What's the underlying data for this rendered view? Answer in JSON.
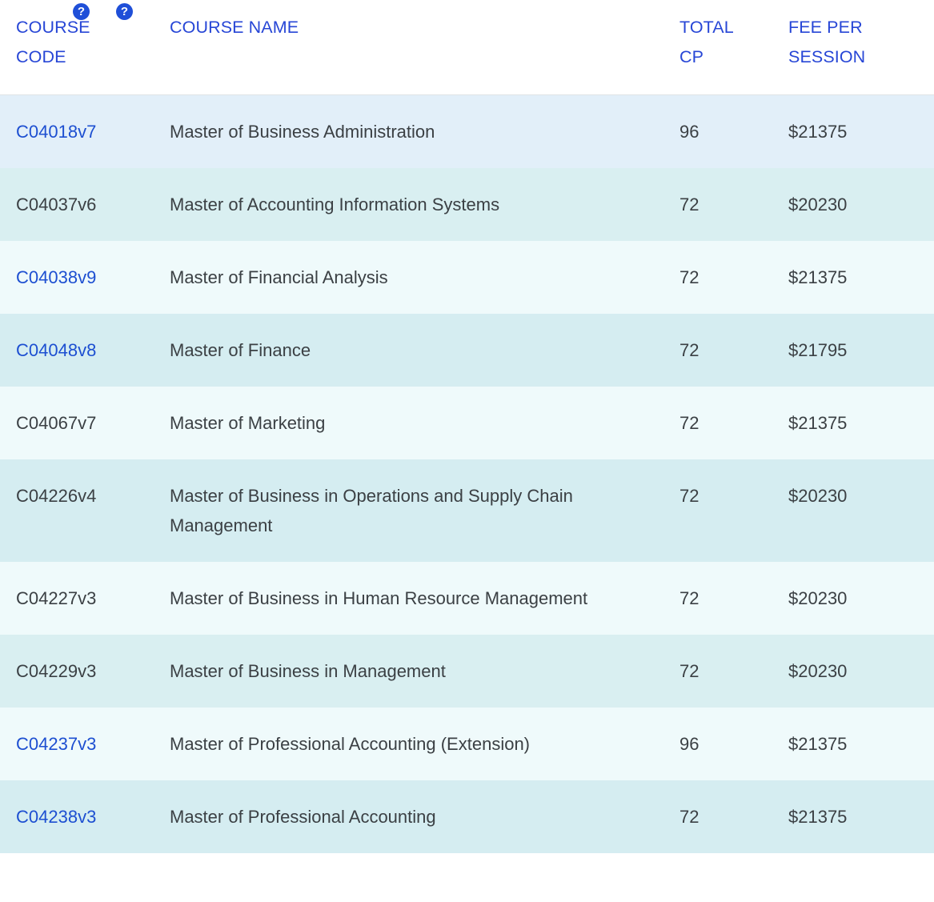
{
  "table": {
    "columns": [
      {
        "key": "course_code",
        "label": "COURSE\nCODE",
        "help_icon": null
      },
      {
        "key": "course_name",
        "label": "COURSE NAME",
        "help_icon": null
      },
      {
        "key": "total_cp",
        "label": "TOTAL\nCP",
        "help_icon": "help-icon"
      },
      {
        "key": "fee_per_session",
        "label": "FEE PER\nSESSION",
        "help_icon": "help-icon"
      }
    ],
    "help_glyph": "?",
    "colors": {
      "header_text": "#2746d6",
      "link": "#1d4fd1",
      "body_text": "#3b4044",
      "help_icon_bg": "#1f4fd8",
      "row_a": "#e2eff9",
      "row_b": "#d9eff1",
      "row_c": "#effafb",
      "row_d": "#d5edf1"
    },
    "rows": [
      {
        "course_code": "C04018v7",
        "is_link": true,
        "course_name": "Master of Business Administration",
        "total_cp": "96",
        "fee_per_session": "$21375"
      },
      {
        "course_code": "C04037v6",
        "is_link": false,
        "course_name": "Master of Accounting Information Systems",
        "total_cp": "72",
        "fee_per_session": "$20230"
      },
      {
        "course_code": "C04038v9",
        "is_link": true,
        "course_name": "Master of Financial Analysis",
        "total_cp": "72",
        "fee_per_session": "$21375"
      },
      {
        "course_code": "C04048v8",
        "is_link": true,
        "course_name": "Master of Finance",
        "total_cp": "72",
        "fee_per_session": "$21795"
      },
      {
        "course_code": "C04067v7",
        "is_link": false,
        "course_name": "Master of Marketing",
        "total_cp": "72",
        "fee_per_session": "$21375"
      },
      {
        "course_code": "C04226v4",
        "is_link": false,
        "course_name": "Master of Business in Operations and Supply Chain Management",
        "total_cp": "72",
        "fee_per_session": "$20230"
      },
      {
        "course_code": "C04227v3",
        "is_link": false,
        "course_name": "Master of Business in Human Resource Management",
        "total_cp": "72",
        "fee_per_session": "$20230"
      },
      {
        "course_code": "C04229v3",
        "is_link": false,
        "course_name": "Master of Business in Management",
        "total_cp": "72",
        "fee_per_session": "$20230"
      },
      {
        "course_code": "C04237v3",
        "is_link": true,
        "course_name": "Master of Professional Accounting (Extension)",
        "total_cp": "96",
        "fee_per_session": "$21375"
      },
      {
        "course_code": "C04238v3",
        "is_link": true,
        "course_name": "Master of Professional Accounting",
        "total_cp": "72",
        "fee_per_session": "$21375"
      }
    ]
  }
}
